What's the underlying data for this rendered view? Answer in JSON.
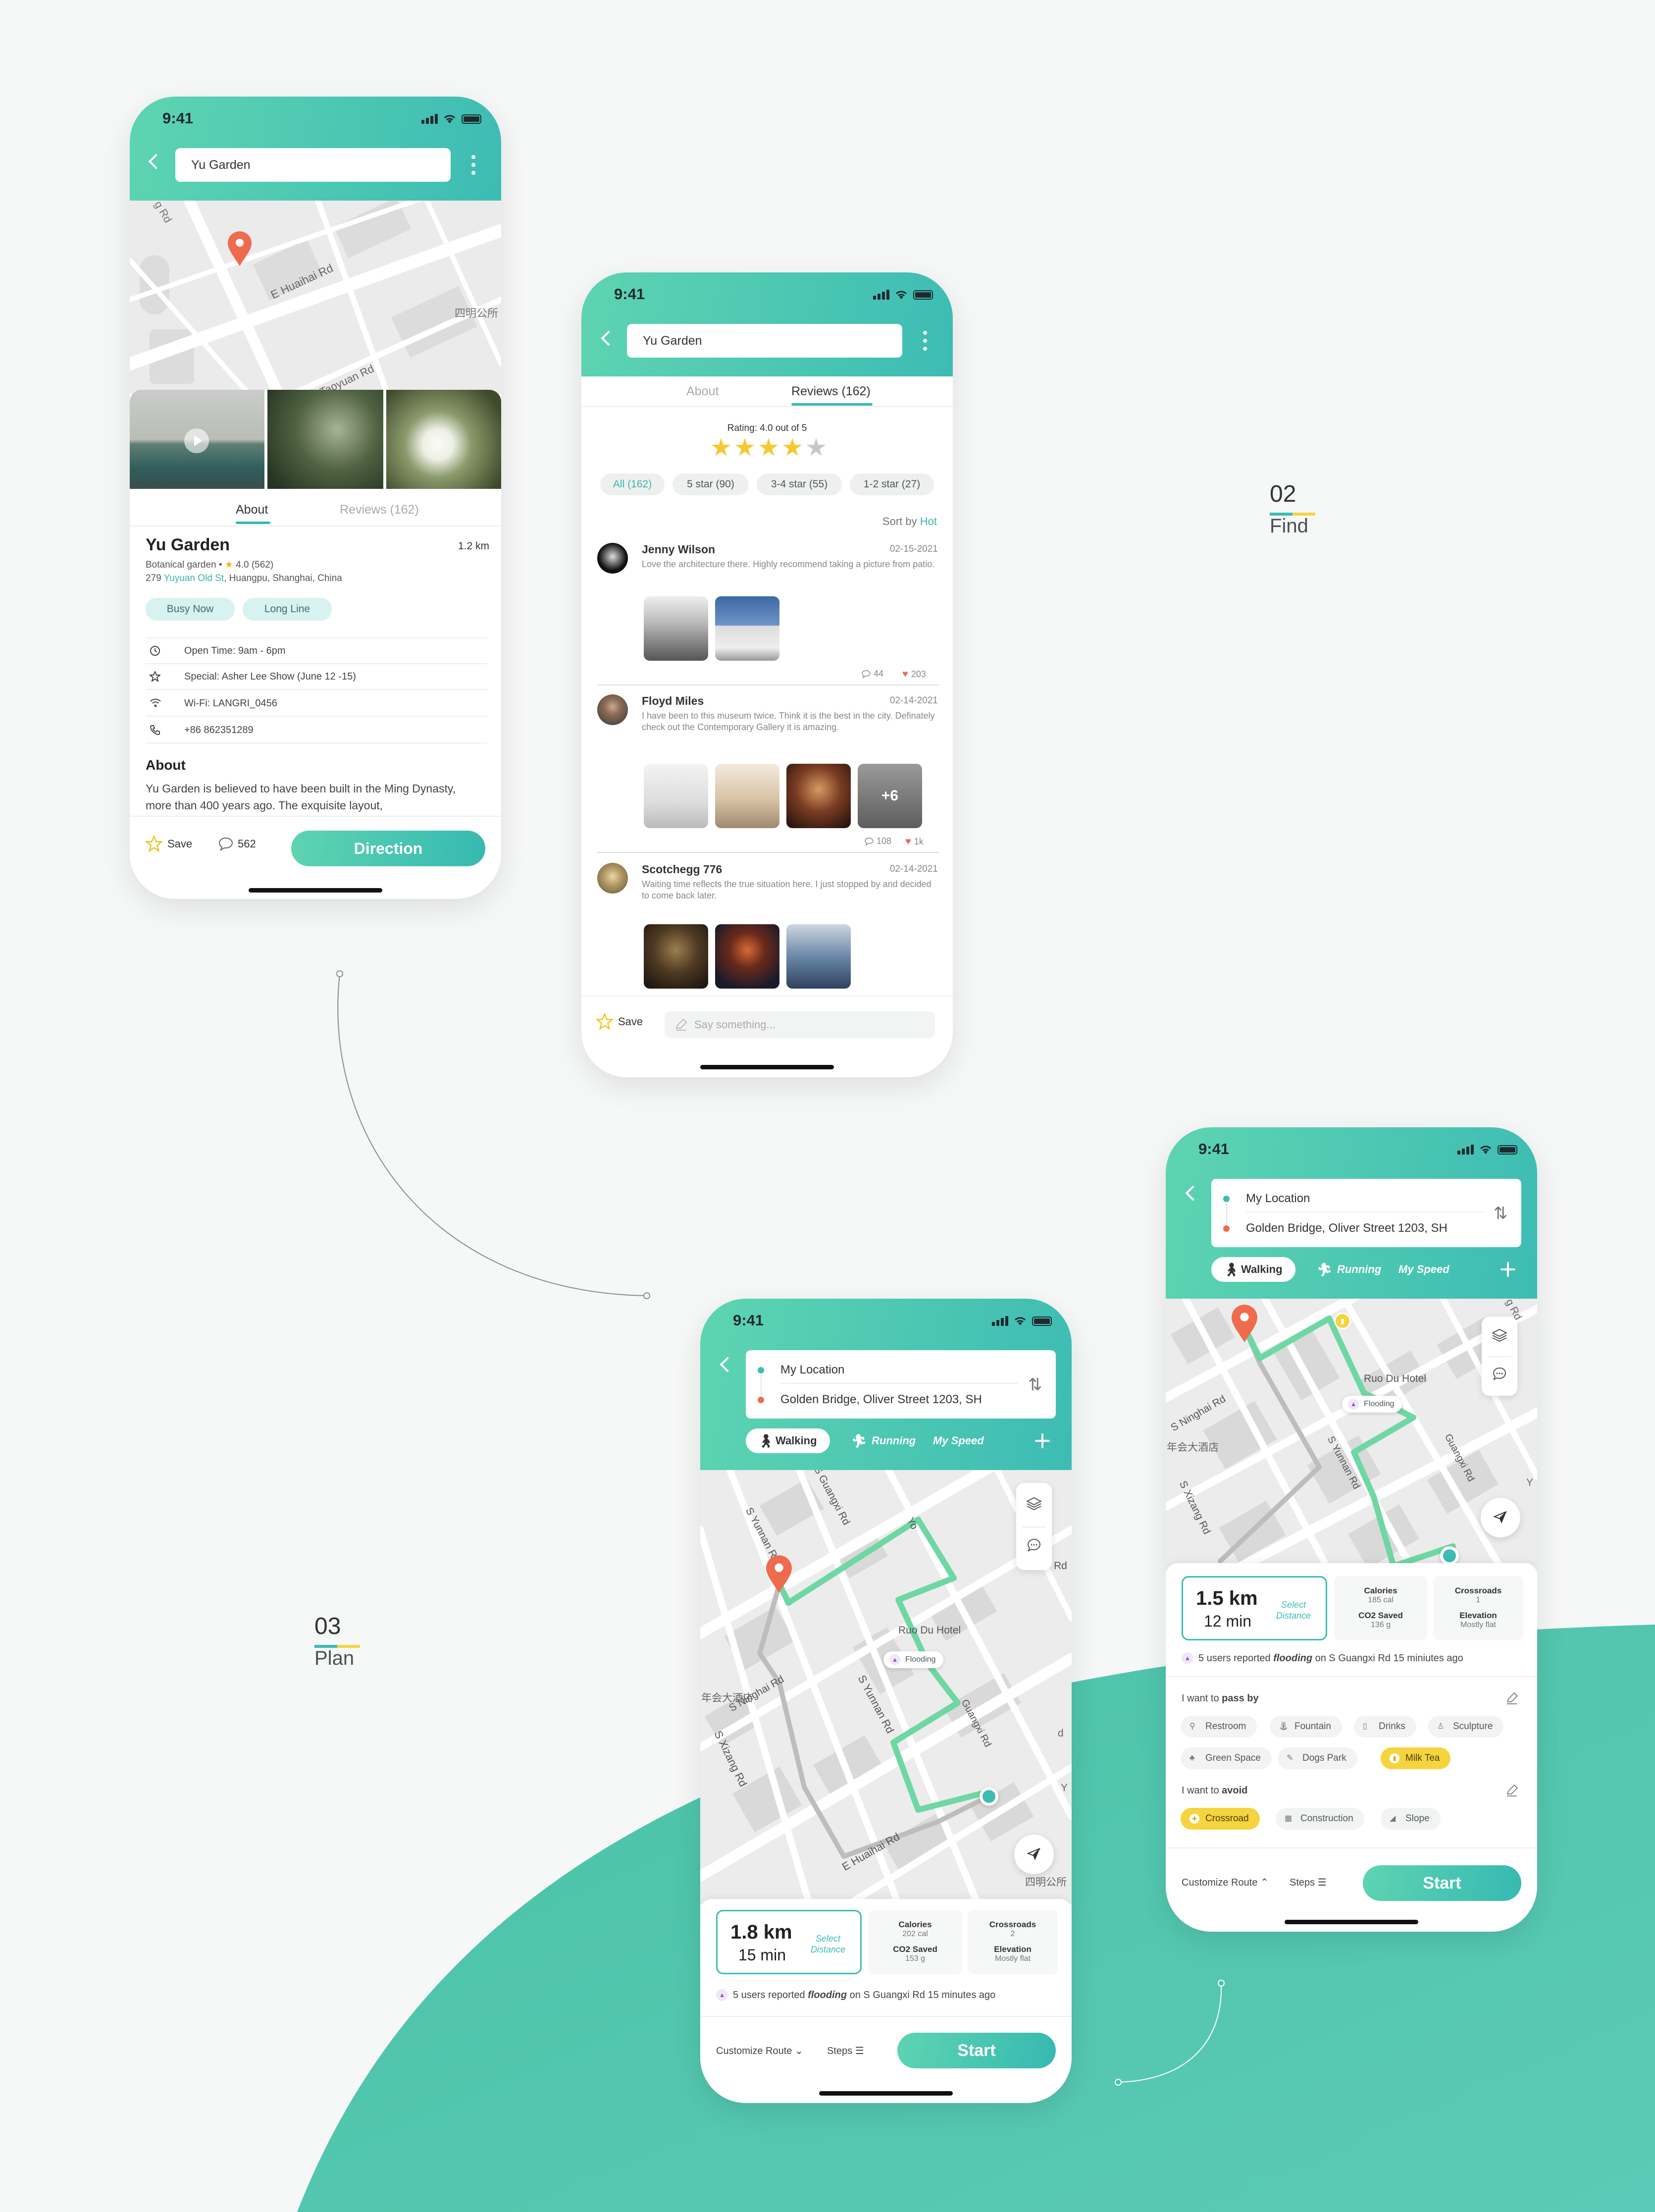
{
  "colors": {
    "teal": "#3dbcb4",
    "mint": "#5ed4b1",
    "orange": "#ee6c4d",
    "yellow": "#f6d43f",
    "bg": "#f6f7f7"
  },
  "sections": [
    {
      "num": "02",
      "label": "Find"
    },
    {
      "num": "03",
      "label": "Plan"
    }
  ],
  "phone1": {
    "time": "9:41",
    "search_value": "Yu Garden",
    "map_labels": [
      "E Huaihai Rd",
      "Taoyuan Rd",
      "四明公所",
      "g Rd"
    ],
    "tabs": [
      "About",
      "Reviews (162)"
    ],
    "place": {
      "name": "Yu Garden",
      "distance": "1.2 km",
      "category": "Botanical garden",
      "rating": "4.0 (562)",
      "address_prefix": "279 ",
      "address_link": "Yuyuan Old St",
      "address_rest": ", Huangpu, Shanghai, China"
    },
    "tags": [
      "Busy Now",
      "Long Line"
    ],
    "info_rows": [
      {
        "icon": "clock-icon",
        "text": "Open Time: 9am - 6pm"
      },
      {
        "icon": "star-outline-icon",
        "text": "Special: Asher Lee Show  (June 12 -15)"
      },
      {
        "icon": "wifi-icon",
        "text": "Wi-Fi: LANGRI_0456"
      },
      {
        "icon": "phone-icon",
        "text": "+86 862351289"
      }
    ],
    "about_title": "About",
    "about_text": "Yu Garden is believed to have been built in the Ming Dynasty, more than 400 years ago. The exquisite layout,",
    "save_label": "Save",
    "comment_count": "562",
    "direction_label": "Direction"
  },
  "phone2": {
    "time": "9:41",
    "search_value": "Yu Garden",
    "tabs": [
      "About",
      "Reviews (162)"
    ],
    "rating_text": "Rating: 4.0 out of 5",
    "rating": 4,
    "filters": [
      "All (162)",
      "5 star (90)",
      "3-4 star (55)",
      "1-2 star (27)"
    ],
    "sort_prefix": "Sort by",
    "sort_value": "Hot",
    "reviews": [
      {
        "name": "Jenny Wilson",
        "date": "02-15-2021",
        "text": "Love the architecture there. Highly recommend taking a picture from patio.",
        "comments": "44",
        "likes": "203"
      },
      {
        "name": "Floyd Miles",
        "date": "02-14-2021",
        "text": "I have been to this museum twice. Think it is the best in the city. Definately check out the Contemporary Gallery it is amazing.",
        "comments": "108",
        "likes": "1k",
        "more": "+6"
      },
      {
        "name": "Scotchegg 776",
        "date": "02-14-2021",
        "text": "Waiting time reflects the true situation here. I just stopped by and decided to come back later."
      }
    ],
    "save_label": "Save",
    "comment_placeholder": "Say something..."
  },
  "phone3": {
    "time": "9:41",
    "from": "My Location",
    "to": "Golden Bridge, Oliver Street 1203, SH",
    "modes": [
      "Walking",
      "Running",
      "My Speed"
    ],
    "map_labels": [
      "S Guangxi Rd",
      "S Yunnan Rd",
      "Yo",
      "Rd",
      "Ruo Du Hotel",
      "Flooding",
      "S Ninghai Rd",
      "年会大酒店",
      "S Xizang Rd",
      "S Yunnan Rd",
      "Guangxi Rd",
      "E Huaihai Rd",
      "四明公所",
      "d",
      "Y"
    ],
    "distance": "1.8 km",
    "time_est": "15 min",
    "select_distance": "Select Distance",
    "calories_label": "Calories",
    "calories": "202 cal",
    "co2_label": "CO2  Saved",
    "co2": "153 g",
    "crossroads_label": "Crossroads",
    "crossroads": "2",
    "elevation_label": "Elevation",
    "elevation": "Mostly flat",
    "alert_prefix": "5 users reported ",
    "alert_em": "flooding",
    "alert_suffix": " on S Guangxi Rd 15 minutes ago",
    "customize": "Customize Route",
    "steps": "Steps",
    "start": "Start"
  },
  "phone4": {
    "time": "9:41",
    "from": "My Location",
    "to": "Golden Bridge, Oliver Street 1203, SH",
    "modes": [
      "Walking",
      "Running",
      "My Speed"
    ],
    "map_labels": [
      "Ruo Du Hotel",
      "Flooding",
      "S Ninghai Rd",
      "年会大酒店",
      "S Yunnan Rd",
      "Guangxi Rd",
      "S Xizang Rd",
      "g Rd",
      "Y"
    ],
    "distance": "1.5 km",
    "time_est": "12 min",
    "select_distance": "Select Distance",
    "calories_label": "Calories",
    "calories": "185 cal",
    "co2_label": "CO2  Saved",
    "co2": "136 g",
    "crossroads_label": "Crossroads",
    "crossroads": "1",
    "elevation_label": "Elevation",
    "elevation": "Mostly flat",
    "alert_prefix": "5 users reported ",
    "alert_em": "flooding",
    "alert_suffix": " on S Guangxi Rd 15 miniutes ago",
    "pass_prefix": "I want to ",
    "pass_bold": "pass by",
    "pass_items": [
      {
        "label": "Restroom",
        "icon": "restroom-icon"
      },
      {
        "label": "Fountain",
        "icon": "fountain-icon"
      },
      {
        "label": "Drinks",
        "icon": "drinks-icon"
      },
      {
        "label": "Sculpture",
        "icon": "sculpture-icon"
      },
      {
        "label": "Green Space",
        "icon": "tree-icon"
      },
      {
        "label": "Dogs Park",
        "icon": "dog-icon"
      },
      {
        "label": "Milk Tea",
        "icon": "milk-tea-icon",
        "selected": true
      }
    ],
    "avoid_prefix": "I want to ",
    "avoid_bold": "avoid",
    "avoid_items": [
      {
        "label": "Crossroad",
        "icon": "crossroad-icon",
        "selected": true
      },
      {
        "label": "Construction",
        "icon": "construction-icon"
      },
      {
        "label": "Slope",
        "icon": "slope-icon"
      }
    ],
    "customize": "Customize Route",
    "steps": "Steps",
    "start": "Start"
  }
}
